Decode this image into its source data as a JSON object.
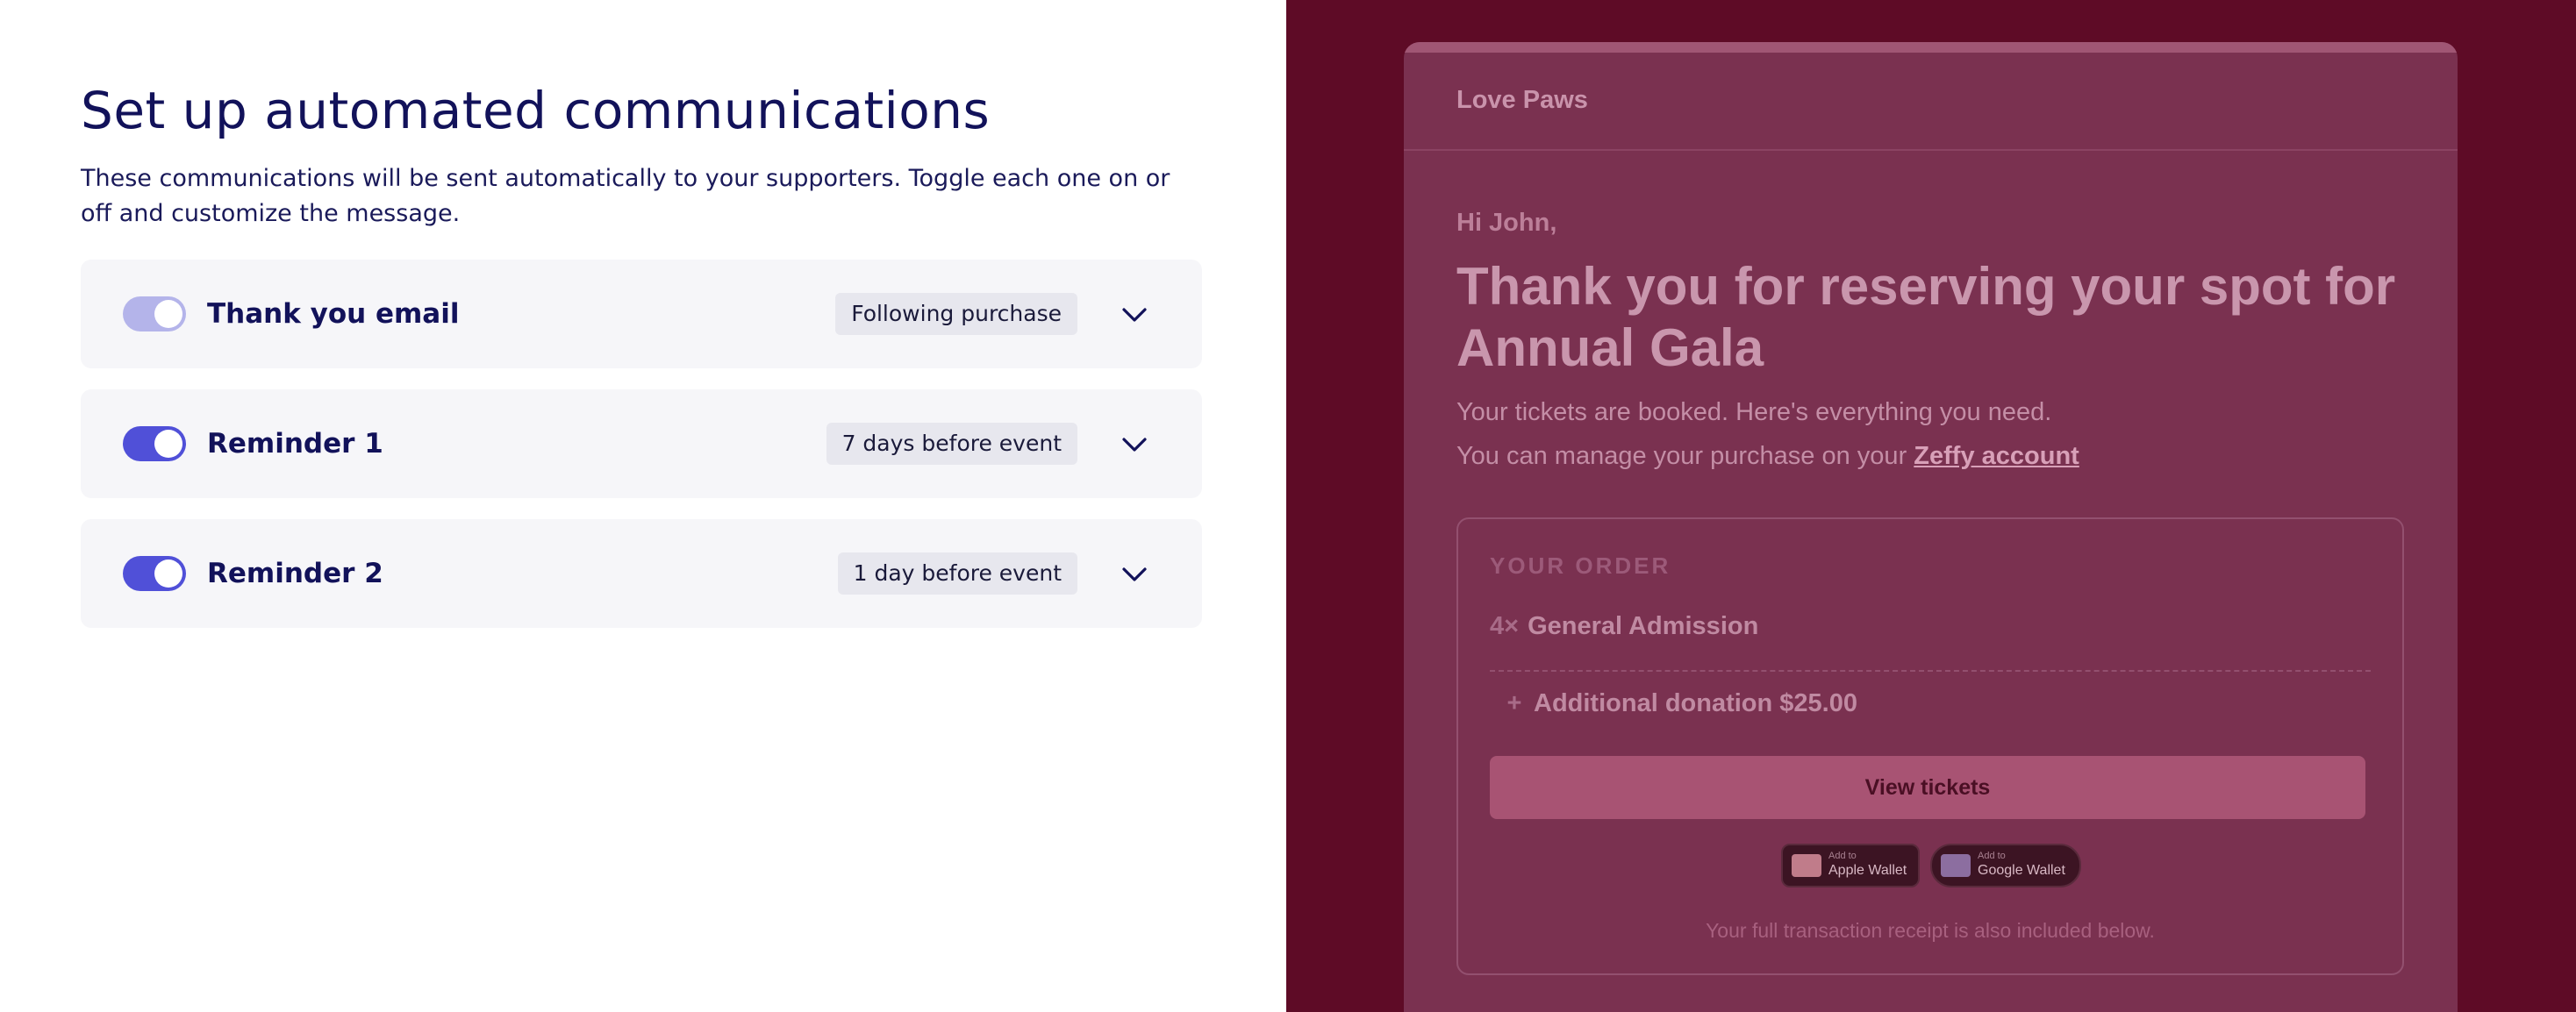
{
  "settings": {
    "title": "Set up automated communications",
    "description": "These communications will be sent automatically to your supporters. Toggle each one on or off and customize the message.",
    "communications": [
      {
        "label": "Thank you email",
        "timing": "Following purchase",
        "enabled": true,
        "toggle_state": "on-disabled"
      },
      {
        "label": "Reminder 1",
        "timing": "7 days before event",
        "enabled": true,
        "toggle_state": "on"
      },
      {
        "label": "Reminder 2",
        "timing": "1 day before event",
        "enabled": true,
        "toggle_state": "on"
      }
    ],
    "icons": {
      "expand": "chevron-down-icon"
    }
  },
  "preview": {
    "org_name": "Love Paws",
    "greeting": "Hi John,",
    "headline": "Thank you for reserving your spot for Annual Gala",
    "subtitle": "Your tickets are booked. Here's everything you need.",
    "manage_text": "You can manage your purchase on your ",
    "manage_link": "Zeffy account",
    "order": {
      "heading": "YOUR ORDER",
      "item_qty": "4×",
      "item_name": "General Admission",
      "donation_symbol": "+",
      "donation_label": "Additional donation $25.00",
      "view_button": "View tickets"
    },
    "wallets": {
      "apple_small": "Add to",
      "apple_big": "Apple Wallet",
      "google_small": "Add to",
      "google_big": "Google Wallet"
    },
    "receipt_note": "Your full transaction receipt is also included below."
  },
  "colors": {
    "accent": "#5050d8",
    "title_text": "#12125a",
    "preview_background": "#5e0b26",
    "preview_card": "#7a3150"
  }
}
